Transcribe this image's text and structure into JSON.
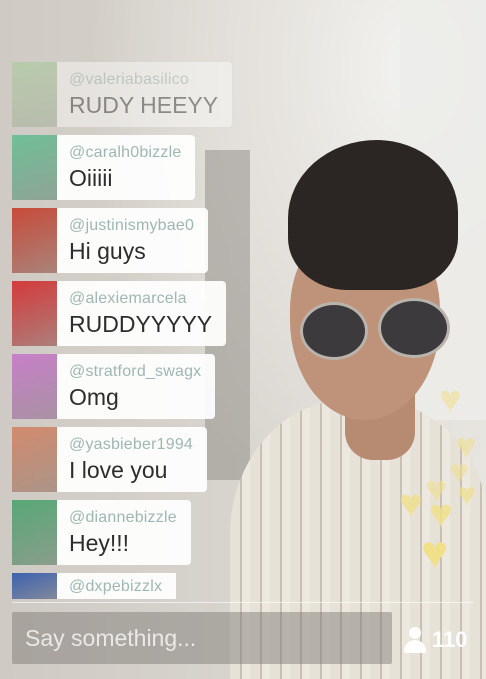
{
  "comments": [
    {
      "user": "@valeriabasilico",
      "message": "RUDY HEEYY",
      "avatar_color": "#9ccc8f"
    },
    {
      "user": "@caralh0bizzle",
      "message": "Oiiiii",
      "avatar_color": "#6fbf97"
    },
    {
      "user": "@justinismybae0",
      "message": "Hi guys",
      "avatar_color": "#c84b3a"
    },
    {
      "user": "@alexiemarcela",
      "message": "RUDDYYYYY",
      "avatar_color": "#d43b3b"
    },
    {
      "user": "@stratford_swagx",
      "message": "Omg",
      "avatar_color": "#c77fc9"
    },
    {
      "user": "@yasbieber1994",
      "message": "I love you",
      "avatar_color": "#d28a6d"
    },
    {
      "user": "@diannebizzle",
      "message": "Hey!!!",
      "avatar_color": "#58a877"
    },
    {
      "user": "@dxpebizzlx",
      "message": "",
      "avatar_color": "#3e62b0"
    }
  ],
  "input": {
    "placeholder": "Say something..."
  },
  "viewers": {
    "count": "110"
  },
  "hearts": {
    "color": "#f0e08a"
  }
}
